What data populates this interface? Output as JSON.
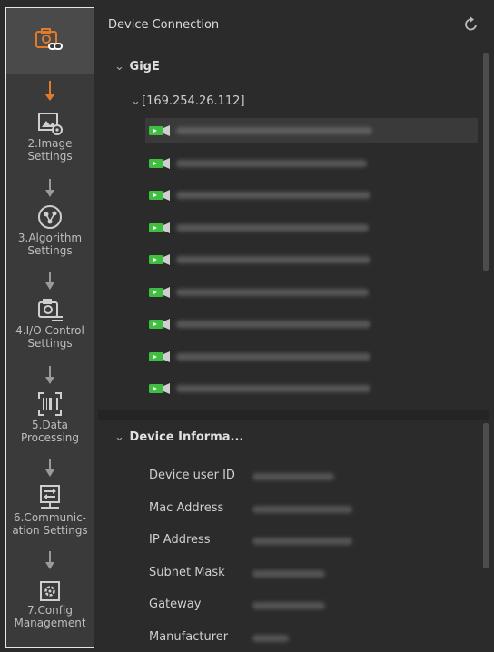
{
  "colors": {
    "accent": "#e07b2c",
    "camera_green": "#3fbf3f",
    "text": "#d6d6d6"
  },
  "sidebar": {
    "steps": [
      {
        "icon": "camera-link-icon",
        "label": ""
      },
      {
        "icon": "image-settings-icon",
        "label": "2.Image\nSettings"
      },
      {
        "icon": "algorithm-icon",
        "label": "3.Algorithm\nSettings"
      },
      {
        "icon": "io-control-icon",
        "label": "4.I/O Control\nSettings"
      },
      {
        "icon": "barcode-icon",
        "label": "5.Data\nProcessing"
      },
      {
        "icon": "communication-icon",
        "label": "6.Communic-\nation Settings"
      },
      {
        "icon": "config-icon",
        "label": "7.Config\nManagement"
      }
    ]
  },
  "panel": {
    "title": "Device Connection",
    "group": "GigE",
    "ip": "[169.254.26.112]",
    "device_count": 9,
    "info_title": "Device Informa...",
    "info_labels": [
      "Device user ID",
      "Mac Address",
      "IP Address",
      "Subnet Mask",
      "Gateway",
      "Manufacturer"
    ]
  }
}
